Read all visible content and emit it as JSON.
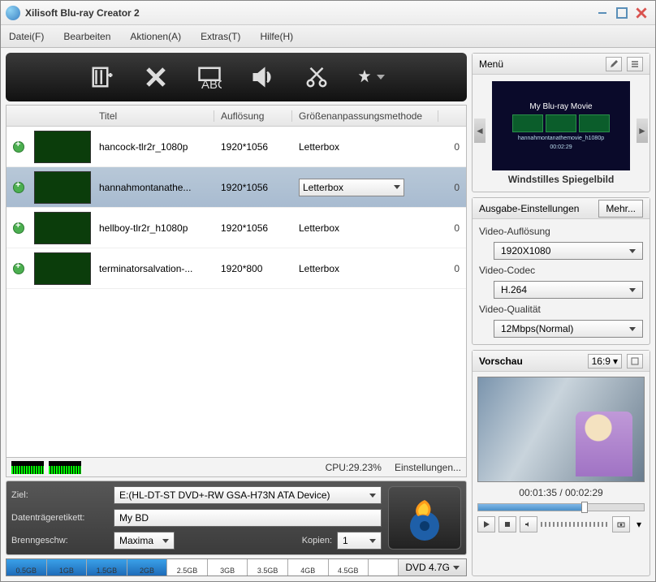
{
  "window": {
    "title": "Xilisoft Blu-ray Creator 2"
  },
  "menu": {
    "items": [
      "Datei(F)",
      "Bearbeiten",
      "Aktionen(A)",
      "Extras(T)",
      "Hilfe(H)"
    ]
  },
  "table": {
    "headers": {
      "title": "Titel",
      "resolution": "Auflösung",
      "fit": "Größenanpassungsmethode"
    },
    "rows": [
      {
        "title": "hancock-tlr2r_1080p",
        "resolution": "1920*1056",
        "fit": "Letterbox",
        "right": "0",
        "selected": false
      },
      {
        "title": "hannahmontanathe...",
        "resolution": "1920*1056",
        "fit": "Letterbox",
        "right": "0",
        "selected": true
      },
      {
        "title": "hellboy-tlr2r_h1080p",
        "resolution": "1920*1056",
        "fit": "Letterbox",
        "right": "0",
        "selected": false
      },
      {
        "title": "terminatorsalvation-...",
        "resolution": "1920*800",
        "fit": "Letterbox",
        "right": "0",
        "selected": false
      }
    ]
  },
  "cpu": {
    "label": "CPU:29.23%",
    "settings": "Einstellungen..."
  },
  "burn": {
    "target_label": "Ziel:",
    "target_value": "E:(HL-DT-ST DVD+-RW GSA-H73N ATA Device)",
    "disc_label_label": "Datenträgeretikett:",
    "disc_label_value": "My BD",
    "speed_label": "Brenngeschw:",
    "speed_value": "Maxima",
    "copies_label": "Kopien:",
    "copies_value": "1"
  },
  "capacity": {
    "ticks": [
      "0.5GB",
      "1GB",
      "1.5GB",
      "2GB",
      "2.5GB",
      "3GB",
      "3.5GB",
      "4GB",
      "4.5GB"
    ],
    "label": "DVD 4.7G"
  },
  "right_menu": {
    "header": "Menü",
    "thumb_title": "My Blu-ray Movie",
    "thumb_sub": "hannahmontanathemovie_h1080p",
    "thumb_time": "00:02:29",
    "caption": "Windstilles Spiegelbild"
  },
  "output": {
    "header": "Ausgabe-Einstellungen",
    "more": "Mehr...",
    "res_label": "Video-Auflösung",
    "res_value": "1920X1080",
    "codec_label": "Video-Codec",
    "codec_value": "H.264",
    "quality_label": "Video-Qualität",
    "quality_value": "12Mbps(Normal)"
  },
  "preview": {
    "header": "Vorschau",
    "aspect": "16:9",
    "time": "00:01:35 / 00:02:29"
  }
}
